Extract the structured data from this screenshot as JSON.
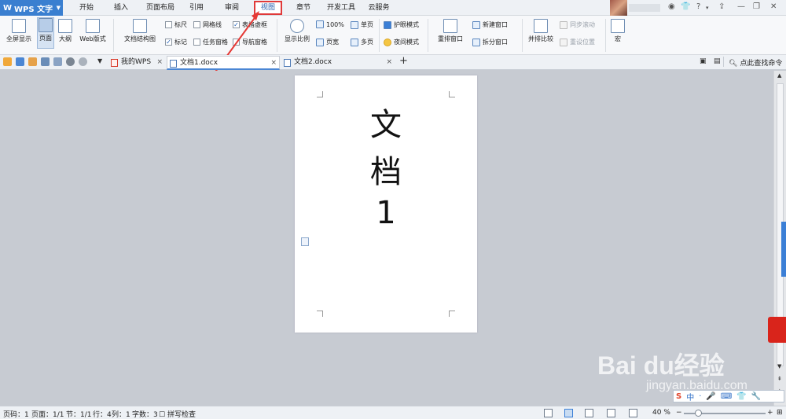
{
  "app": {
    "name": "WPS 文字",
    "logo": "W"
  },
  "menu_tabs": [
    "开始",
    "插入",
    "页面布局",
    "引用",
    "审阅",
    "视图",
    "章节",
    "开发工具",
    "云服务"
  ],
  "active_menu_tab": "视图",
  "ribbon": {
    "full_screen": "全屏显示",
    "page_view": "页面",
    "outline": "大纲",
    "web_layout": "Web版式",
    "doc_structure": "文档结构图",
    "ruler": "标尺",
    "gridlines": "网格线",
    "table_gridlines": "表格虚框",
    "markup": "标记",
    "task_pane": "任务窗格",
    "nav_pane": "导航窗格",
    "zoom": "显示比例",
    "percent_100": "100%",
    "page_width": "页宽",
    "single_page": "单页",
    "multi_page": "多页",
    "eye_protect": "护眼模式",
    "night_mode": "夜间模式",
    "arrange_windows": "重排窗口",
    "new_window": "新建窗口",
    "split_window": "拆分窗口",
    "side_by_side": "并排比较",
    "sync_scroll": "同步滚动",
    "reset_position": "重设位置",
    "macro": "宏"
  },
  "doc_tabs": [
    {
      "label": "我的WPS"
    },
    {
      "label": "文档1.docx",
      "active": true
    },
    {
      "label": "文档2.docx"
    }
  ],
  "search_commands": "点此查找命令",
  "document": {
    "lines": [
      "文",
      "档",
      "1"
    ]
  },
  "watermark": {
    "brand": "Bai du经验",
    "url": "jingyan.baidu.com"
  },
  "ime": [
    "中",
    "·",
    "🎤",
    "⌨",
    "👕",
    "🔧"
  ],
  "status": {
    "page_no": "页码：1",
    "pages": "页面：1/1",
    "section": "节：1/1",
    "row": "行：4",
    "column": "列：1",
    "word_count": "字数：3",
    "spell_check": "拼写检查",
    "zoom_label": "40 %"
  },
  "colors": {
    "accent": "#3a7fd0",
    "highlight_box": "#e03a3a",
    "arrow": "#e53935"
  }
}
